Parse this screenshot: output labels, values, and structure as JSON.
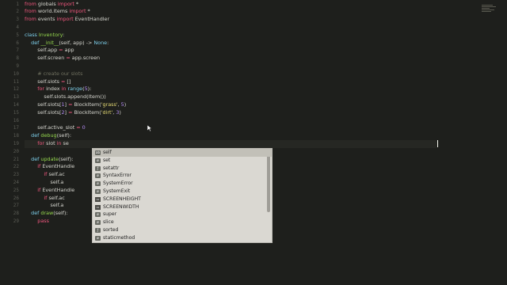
{
  "editor": {
    "theme_colors": {
      "background": "#1e1f1c",
      "keyword": "#f0577e",
      "function": "#7ed0ec",
      "class": "#96d84e",
      "string": "#e6db74",
      "number": "#b48cf5",
      "comment": "#6f705f"
    },
    "line_numbers": [
      "1",
      "2",
      "3",
      "4",
      "5",
      "6",
      "7",
      "8",
      "9",
      "10",
      "11",
      "12",
      "13",
      "14",
      "15",
      "16",
      "17",
      "18",
      "19",
      "20",
      "21",
      "22",
      "23",
      "24",
      "25",
      "26",
      "27",
      "28"
    ],
    "lines": [
      {
        "n": 1,
        "tokens": [
          [
            "kw",
            "from "
          ],
          [
            "txt",
            "globals "
          ],
          [
            "kw",
            "import "
          ],
          [
            "txt",
            "*"
          ]
        ]
      },
      {
        "n": 2,
        "tokens": [
          [
            "kw",
            "from "
          ],
          [
            "txt",
            "world.items "
          ],
          [
            "kw",
            "import "
          ],
          [
            "txt",
            "*"
          ]
        ]
      },
      {
        "n": 3,
        "tokens": [
          [
            "kw",
            "from "
          ],
          [
            "txt",
            "events "
          ],
          [
            "kw",
            "import "
          ],
          [
            "txt",
            "EventHandler"
          ]
        ]
      },
      {
        "n": 4,
        "tokens": []
      },
      {
        "n": 5,
        "tokens": [
          [
            "fn",
            "class "
          ],
          [
            "cls",
            "Inventory"
          ],
          [
            "txt",
            ":"
          ]
        ]
      },
      {
        "n": 6,
        "tokens": [
          [
            "txt",
            "    "
          ],
          [
            "fn",
            "def "
          ],
          [
            "cls",
            "__init__"
          ],
          [
            "txt",
            "(self, app) -> "
          ],
          [
            "fn",
            "None"
          ],
          [
            "txt",
            ":"
          ]
        ]
      },
      {
        "n": 7,
        "tokens": [
          [
            "txt",
            "        self.app "
          ],
          [
            "kw",
            "= "
          ],
          [
            "txt",
            "app"
          ]
        ]
      },
      {
        "n": 8,
        "tokens": [
          [
            "txt",
            "        self.screen "
          ],
          [
            "kw",
            "= "
          ],
          [
            "txt",
            "app.screen"
          ]
        ]
      },
      {
        "n": 9,
        "tokens": []
      },
      {
        "n": 10,
        "tokens": [
          [
            "cm",
            "        # create our slots"
          ]
        ]
      },
      {
        "n": 11,
        "tokens": [
          [
            "txt",
            "        self.slots "
          ],
          [
            "kw",
            "= "
          ],
          [
            "txt",
            "[]"
          ]
        ]
      },
      {
        "n": 12,
        "tokens": [
          [
            "txt",
            "        "
          ],
          [
            "kw",
            "for "
          ],
          [
            "txt",
            "index "
          ],
          [
            "kw",
            "in "
          ],
          [
            "fn",
            "range"
          ],
          [
            "txt",
            "("
          ],
          [
            "num",
            "5"
          ],
          [
            "txt",
            "):"
          ]
        ]
      },
      {
        "n": 13,
        "tokens": [
          [
            "txt",
            "            self.slots.append(Item())"
          ]
        ]
      },
      {
        "n": 14,
        "tokens": [
          [
            "txt",
            "        self.slots["
          ],
          [
            "num",
            "1"
          ],
          [
            "txt",
            "] "
          ],
          [
            "kw",
            "= "
          ],
          [
            "txt",
            "BlockItem("
          ],
          [
            "str",
            "'grass'"
          ],
          [
            "txt",
            ", "
          ],
          [
            "num",
            "5"
          ],
          [
            "txt",
            ")"
          ]
        ]
      },
      {
        "n": 15,
        "tokens": [
          [
            "txt",
            "        self.slots["
          ],
          [
            "num",
            "2"
          ],
          [
            "txt",
            "] "
          ],
          [
            "kw",
            "= "
          ],
          [
            "txt",
            "BlockItem("
          ],
          [
            "str",
            "'dirt'"
          ],
          [
            "txt",
            ", "
          ],
          [
            "num",
            "3"
          ],
          [
            "txt",
            ")"
          ]
        ]
      },
      {
        "n": 16,
        "tokens": []
      },
      {
        "n": 17,
        "tokens": [
          [
            "txt",
            "        self.active_slot "
          ],
          [
            "kw",
            "= "
          ],
          [
            "num",
            "0"
          ]
        ]
      },
      {
        "n": 18,
        "tokens": [
          [
            "txt",
            "    "
          ],
          [
            "fn",
            "def "
          ],
          [
            "cls",
            "debug"
          ],
          [
            "txt",
            "(self):"
          ]
        ]
      },
      {
        "n": 19,
        "tokens": [
          [
            "txt",
            "        "
          ],
          [
            "kw",
            "for "
          ],
          [
            "txt",
            "slot "
          ],
          [
            "kw",
            "in "
          ],
          [
            "txt",
            "se"
          ]
        ]
      },
      {
        "n": 20,
        "tokens": []
      },
      {
        "n": 21,
        "tokens": [
          [
            "txt",
            "    "
          ],
          [
            "fn",
            "def "
          ],
          [
            "cls",
            "update"
          ],
          [
            "txt",
            "(self):"
          ]
        ]
      },
      {
        "n": 22,
        "tokens": [
          [
            "txt",
            "        "
          ],
          [
            "kw",
            "if "
          ],
          [
            "txt",
            "EventHandle"
          ]
        ]
      },
      {
        "n": 23,
        "tokens": [
          [
            "txt",
            "            "
          ],
          [
            "kw",
            "if "
          ],
          [
            "txt",
            "self.ac"
          ]
        ]
      },
      {
        "n": 24,
        "tokens": [
          [
            "txt",
            "                self.a"
          ]
        ]
      },
      {
        "n": 25,
        "tokens": [
          [
            "txt",
            "        "
          ],
          [
            "kw",
            "if "
          ],
          [
            "txt",
            "EventHandle"
          ]
        ]
      },
      {
        "n": 26,
        "tokens": [
          [
            "txt",
            "            "
          ],
          [
            "kw",
            "if "
          ],
          [
            "txt",
            "self.ac"
          ]
        ]
      },
      {
        "n": 27,
        "tokens": [
          [
            "txt",
            "                self.a"
          ]
        ]
      },
      {
        "n": 28,
        "tokens": [
          [
            "txt",
            "    "
          ],
          [
            "fn",
            "def "
          ],
          [
            "cls",
            "draw"
          ],
          [
            "txt",
            "(self):"
          ]
        ]
      },
      {
        "n": 29,
        "tokens": [
          [
            "txt",
            "        "
          ],
          [
            "kw",
            "pass"
          ]
        ]
      }
    ]
  },
  "autocomplete": {
    "items": [
      {
        "label": "self",
        "icon": "variable-icon"
      },
      {
        "label": "set",
        "icon": "class-icon"
      },
      {
        "label": "setattr",
        "icon": "function-icon"
      },
      {
        "label": "SyntaxError",
        "icon": "class-icon"
      },
      {
        "label": "SystemError",
        "icon": "class-icon"
      },
      {
        "label": "SystemExit",
        "icon": "class-icon"
      },
      {
        "label": "SCREENHEIGHT",
        "icon": "constant-icon"
      },
      {
        "label": "SCREENWIDTH",
        "icon": "constant-icon"
      },
      {
        "label": "super",
        "icon": "class-icon"
      },
      {
        "label": "slice",
        "icon": "class-icon"
      },
      {
        "label": "sorted",
        "icon": "function-icon"
      },
      {
        "label": "staticmethod",
        "icon": "class-icon"
      }
    ],
    "selected_index": 0
  }
}
